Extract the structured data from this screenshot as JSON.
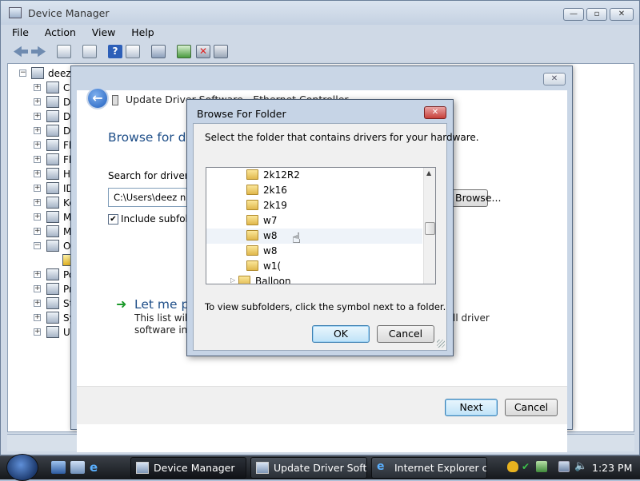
{
  "device_manager": {
    "title": "Device Manager",
    "menu": [
      "File",
      "Action",
      "View",
      "Help"
    ],
    "toolbar_icons": [
      "back-icon",
      "forward-icon",
      "properties-icon",
      "view-icon",
      "help-icon",
      "view-details-icon",
      "scan-hardware-icon",
      "update-driver-icon",
      "uninstall-icon",
      "disable-icon"
    ],
    "tree_root": "deezn",
    "tree_items": [
      {
        "label": "Co",
        "expander": "+"
      },
      {
        "label": "Di",
        "expander": "+"
      },
      {
        "label": "Di",
        "expander": "+"
      },
      {
        "label": "DV",
        "expander": "+"
      },
      {
        "label": "Flo",
        "expander": "+"
      },
      {
        "label": "Flo",
        "expander": "+"
      },
      {
        "label": "Hu",
        "expander": "+"
      },
      {
        "label": "ID",
        "expander": "+"
      },
      {
        "label": "Ke",
        "expander": "+"
      },
      {
        "label": "Mi",
        "expander": "+"
      },
      {
        "label": "Mo",
        "expander": "+"
      },
      {
        "label": "Ot",
        "expander": "−"
      },
      {
        "label": "",
        "expander": ""
      },
      {
        "label": "Po",
        "expander": "+"
      },
      {
        "label": "Pr",
        "expander": "+"
      },
      {
        "label": "St",
        "expander": "+"
      },
      {
        "label": "Sy",
        "expander": "+"
      },
      {
        "label": "Ur",
        "expander": "+"
      }
    ]
  },
  "update_driver": {
    "title": "Update Driver Software - Ethernet Controller",
    "heading": "Browse for driver software on your computer",
    "search_label": "Search for driver software in this location:",
    "path_value": "C:\\Users\\deez nuts\\Desktop",
    "browse_button": "Browse...",
    "include_subfolders": "Include subfolders",
    "include_checked": "✔",
    "let_me_pick": "Let me pick from a list of device drivers on my computer",
    "list_line1": "This list will show installed driver software compatible with the device, and all driver",
    "list_line2": "software in the same category as the device.",
    "side_text": "ll driver",
    "next_button": "Next",
    "cancel_button": "Cancel"
  },
  "browse_folder": {
    "title": "Browse For Folder",
    "close_glyph": "✕",
    "prompt": "Select the folder that contains drivers for your hardware.",
    "folders": [
      {
        "label": "2k12R2",
        "indent": 2,
        "selected": false
      },
      {
        "label": "2k16",
        "indent": 2,
        "selected": false
      },
      {
        "label": "2k19",
        "indent": 2,
        "selected": false
      },
      {
        "label": "w7",
        "indent": 2,
        "selected": false
      },
      {
        "label": "w8",
        "indent": 2,
        "selected": true
      },
      {
        "label": "w8",
        "indent": 2,
        "selected": false
      },
      {
        "label": "w1(",
        "indent": 2,
        "selected": false
      },
      {
        "label": "Balloon",
        "indent": 1,
        "selected": false
      }
    ],
    "hint": "To view subfolders, click the symbol next to a folder.",
    "ok_button": "OK",
    "cancel_button": "Cancel",
    "scroll_up": "▲"
  },
  "taskbar": {
    "tasks": [
      "Device Manager",
      "Update Driver Soft...",
      "Internet Explorer c..."
    ],
    "clock": "1:23 PM"
  },
  "colors": {
    "heading_blue": "#1e4e88",
    "arrow_green": "#1c9a2a",
    "close_red": "#c7403a"
  }
}
